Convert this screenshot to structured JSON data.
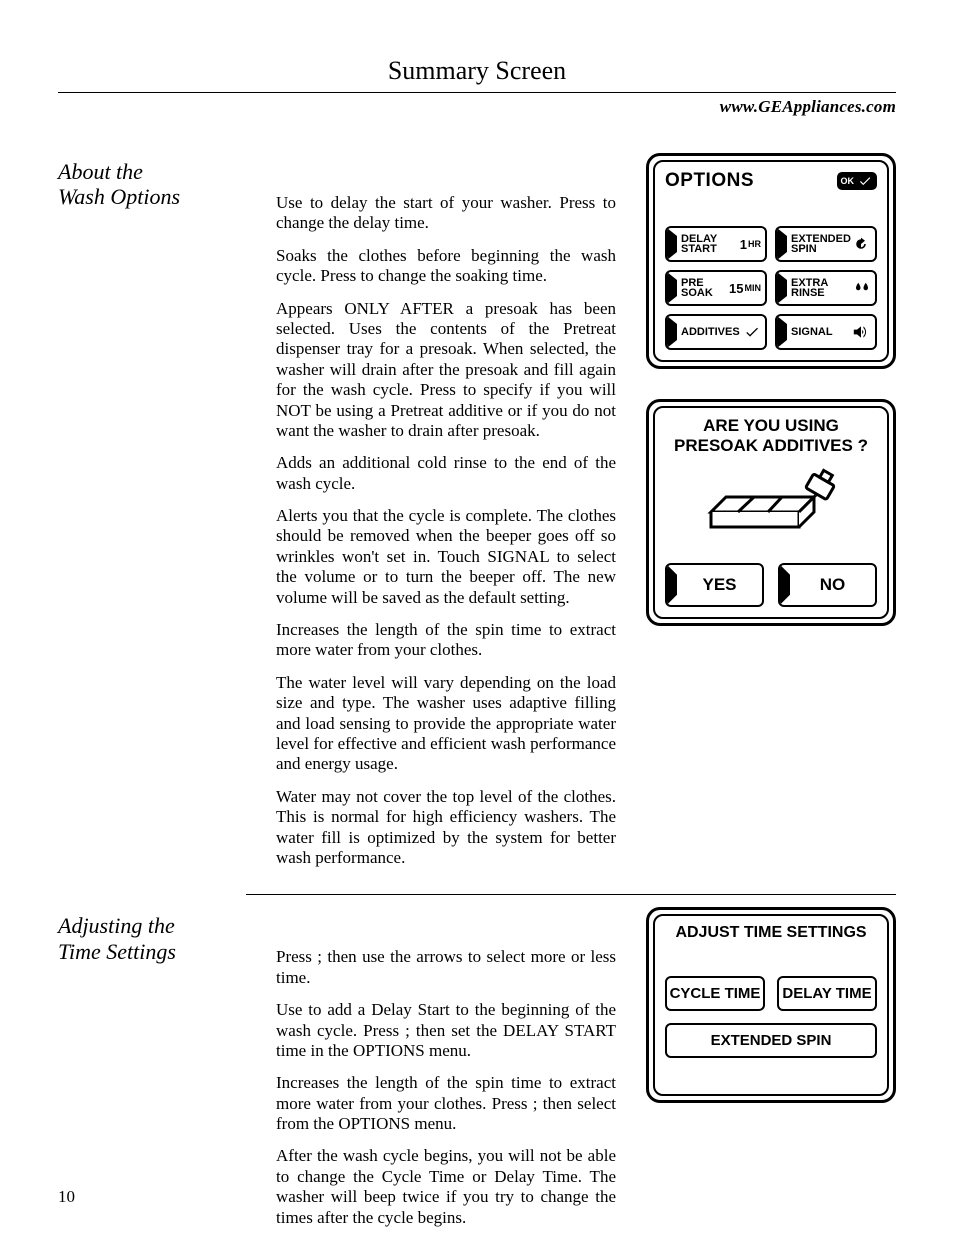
{
  "page_number": "10",
  "header": {
    "title": "Summary Screen",
    "site": "www.GEAppliances.com"
  },
  "sec1": {
    "title_l1": "About the",
    "title_l2": "Wash Options",
    "p1a": "Use to delay the start of your washer. Press ",
    "p1b": " to change the delay time.",
    "p2a": "Soaks the clothes before beginning the wash cycle. Press ",
    "p2b": " to change the soaking time.",
    "p3a": "Appears ONLY AFTER a presoak has been selected. Uses the contents of the Pretreat dispenser tray for a presoak. When selected, the washer will drain after the presoak and fill again for the wash cycle. Press ",
    "p3b": " to specify if you will NOT be using a Pretreat additive or if you do not want the washer to drain after presoak.",
    "p4": "Adds an additional cold rinse to the end of the wash cycle.",
    "p5": "Alerts you that the cycle is complete. The clothes should be removed when the beeper goes off so wrinkles won't set in. Touch SIGNAL to select the volume or to turn the beeper off. The new volume will be saved as the default setting.",
    "p6": "Increases the length of the spin time to extract more water from your clothes.",
    "p7": "The water level will vary depending on the load size and type. The washer uses adaptive filling and load sensing to provide the appropriate water level for effective and efficient wash performance and energy usage.",
    "p8": "Water may not cover the top level of the clothes. This is normal for high efficiency washers. The water fill is optimized by the system for better wash performance."
  },
  "options_panel": {
    "title": "OPTIONS",
    "ok": "OK",
    "delay_start_label": "DELAY\nSTART",
    "delay_start_value": "1",
    "delay_start_unit": "HR",
    "extended_spin_label": "EXTENDED\nSPIN",
    "pre_soak_label": "PRE\nSOAK",
    "pre_soak_value": "15",
    "pre_soak_unit": "MIN",
    "extra_rinse_label": "EXTRA\nRINSE",
    "additives_label": "ADDITIVES",
    "signal_label": "SIGNAL"
  },
  "presoak_panel": {
    "line1": "ARE YOU USING",
    "line2": "PRESOAK ADDITIVES ?",
    "yes": "YES",
    "no": "NO"
  },
  "sec2": {
    "title_l1": "Adjusting the",
    "title_l2": "Time Settings",
    "p1a": "Press ",
    "p1b": "; then use the arrows to select more or less time.",
    "p2a": "Use to add a Delay Start to the beginning of the wash cycle. Press ",
    "p2b": "; then set the DELAY START time in the OPTIONS menu.",
    "p3a": "Increases the length of the spin time to extract more water from your clothes. Press ",
    "p3b": "; then select ",
    "p3c": " from the OPTIONS menu.",
    "p4": "After the wash cycle begins, you will not be able to change the Cycle Time or Delay Time. The washer will beep twice if you try to change the times after the cycle begins."
  },
  "ats_panel": {
    "title": "ADJUST TIME SETTINGS",
    "cycle_time": "CYCLE TIME",
    "delay_time": "DELAY TIME",
    "extended_spin": "EXTENDED SPIN"
  }
}
